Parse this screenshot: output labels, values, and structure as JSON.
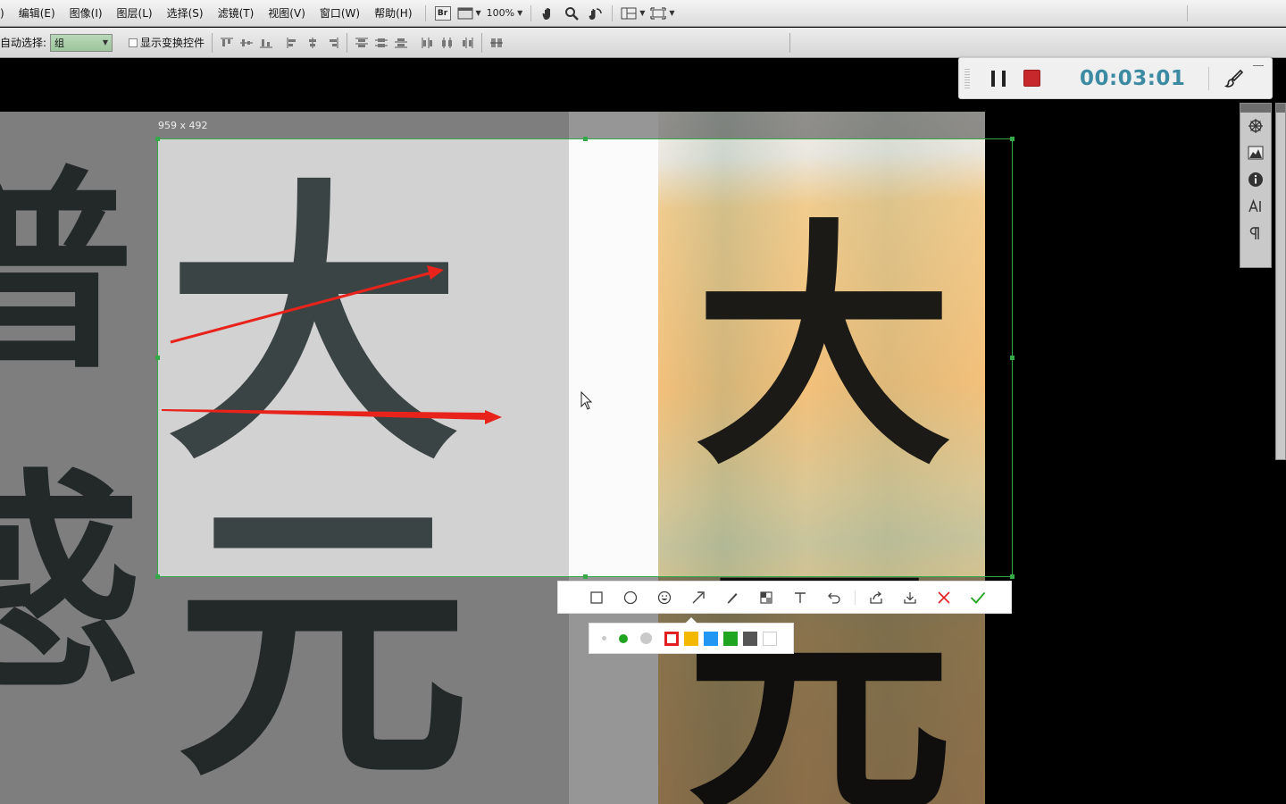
{
  "menubar": {
    "items": [
      "编辑(E)",
      "图像(I)",
      "图层(L)",
      "选择(S)",
      "滤镜(T)",
      "视图(V)",
      "窗口(W)",
      "帮助(H)"
    ],
    "br_label": "Br",
    "zoom": "100%"
  },
  "options": {
    "auto_select_label": "自动选择:",
    "auto_select_value": "组",
    "show_transform_label": "显示变换控件"
  },
  "recorder": {
    "time": "00:03:01"
  },
  "selection": {
    "size_label": "959 x 492"
  },
  "canvas": {
    "left_glyphs": {
      "main_top": "大",
      "main_bottom": "元",
      "side_top": "普",
      "side_bottom": "惑"
    },
    "right_glyphs": {
      "top": "大",
      "bottom": "元"
    }
  },
  "annotation": {
    "tools": [
      "rectangle",
      "ellipse",
      "emoji",
      "arrow",
      "pen",
      "mosaic",
      "text",
      "undo",
      "share",
      "download",
      "cancel",
      "confirm"
    ],
    "colors": {
      "red": "#e02020",
      "yellow": "#f5b800",
      "blue": "#2196f3",
      "green": "#1fa51f",
      "dark_gray": "#555555",
      "white": "#ffffff"
    },
    "selected_color": "red"
  },
  "accent": {
    "selection_green": "#35a84a",
    "timer_teal": "#3d8aa3",
    "stop_red": "#c6282b",
    "arrow_red": "#e8231b"
  }
}
